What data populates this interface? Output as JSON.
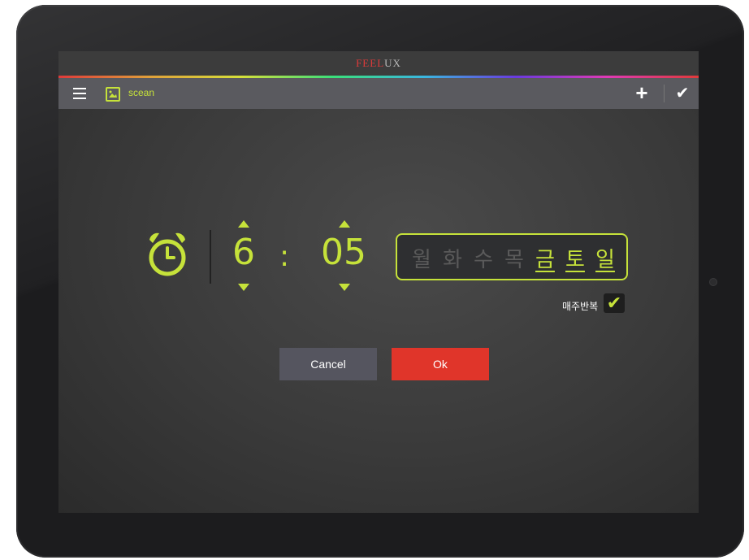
{
  "app": {
    "brand_part1": "FEEL",
    "brand_part2": "UX"
  },
  "toolbar": {
    "scene_label": "scean",
    "icons": [
      "menu-icon",
      "image-icon",
      "plus-icon",
      "check-icon"
    ]
  },
  "alarm": {
    "hour": "6",
    "separator": ":",
    "minute": "05",
    "days": [
      {
        "label": "월",
        "active": false
      },
      {
        "label": "화",
        "active": false
      },
      {
        "label": "수",
        "active": false
      },
      {
        "label": "목",
        "active": false
      },
      {
        "label": "금",
        "active": true
      },
      {
        "label": "토",
        "active": true
      },
      {
        "label": "일",
        "active": true
      }
    ],
    "repeat_label": "매주반복",
    "repeat_checked": true
  },
  "buttons": {
    "cancel": "Cancel",
    "ok": "Ok"
  },
  "colors": {
    "accent": "#c6e23a",
    "ok": "#e0352a",
    "cancel": "#55555f"
  }
}
